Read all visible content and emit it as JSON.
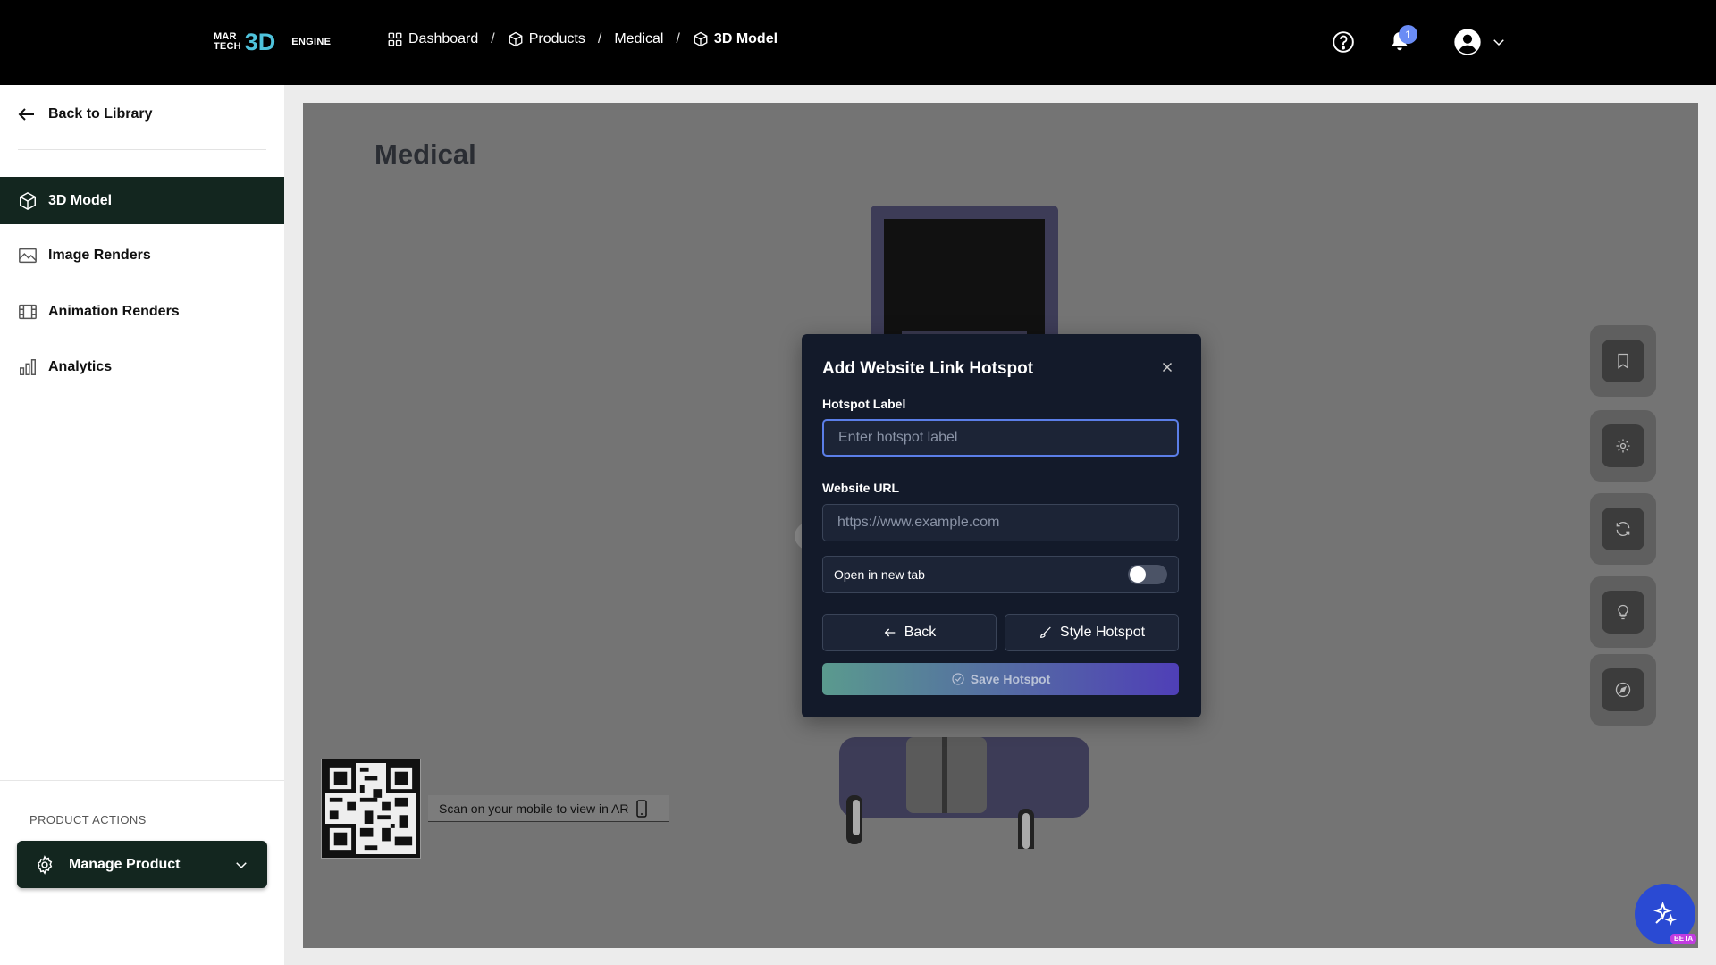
{
  "brand": {
    "line1": "MAR",
    "line2": "TECH",
    "mark": "3D",
    "engine": "ENGINE",
    "accent": "#4fc3dc"
  },
  "breadcrumbs": [
    {
      "label": "Dashboard",
      "icon": "grid-icon"
    },
    {
      "label": "Products",
      "icon": "cube-icon"
    },
    {
      "label": "Medical",
      "icon": ""
    },
    {
      "label": "3D Model",
      "icon": "cube-icon"
    }
  ],
  "header": {
    "notification_count": "1"
  },
  "sidebar": {
    "back_label": "Back to Library",
    "items": [
      {
        "label": "3D Model",
        "icon": "cube-icon",
        "active": true
      },
      {
        "label": "Image Renders",
        "icon": "image-icon"
      },
      {
        "label": "Animation Renders",
        "icon": "film-icon"
      },
      {
        "label": "Analytics",
        "icon": "bar-chart-icon"
      }
    ],
    "section_label": "PRODUCT ACTIONS",
    "manage_label": "Manage Product"
  },
  "viewer": {
    "title": "Medical",
    "ar_text": "Scan on your mobile to view in AR",
    "beta": "BETA"
  },
  "modal": {
    "title": "Add Website Link Hotspot",
    "label_field": {
      "label": "Hotspot Label",
      "value": "",
      "placeholder": "Enter hotspot label"
    },
    "url_field": {
      "label": "Website URL",
      "value": "",
      "placeholder": "https://www.example.com"
    },
    "new_tab_label": "Open in new tab",
    "new_tab_on": false,
    "back_label": "Back",
    "style_label": "Style Hotspot",
    "save_label": "Save Hotspot"
  }
}
